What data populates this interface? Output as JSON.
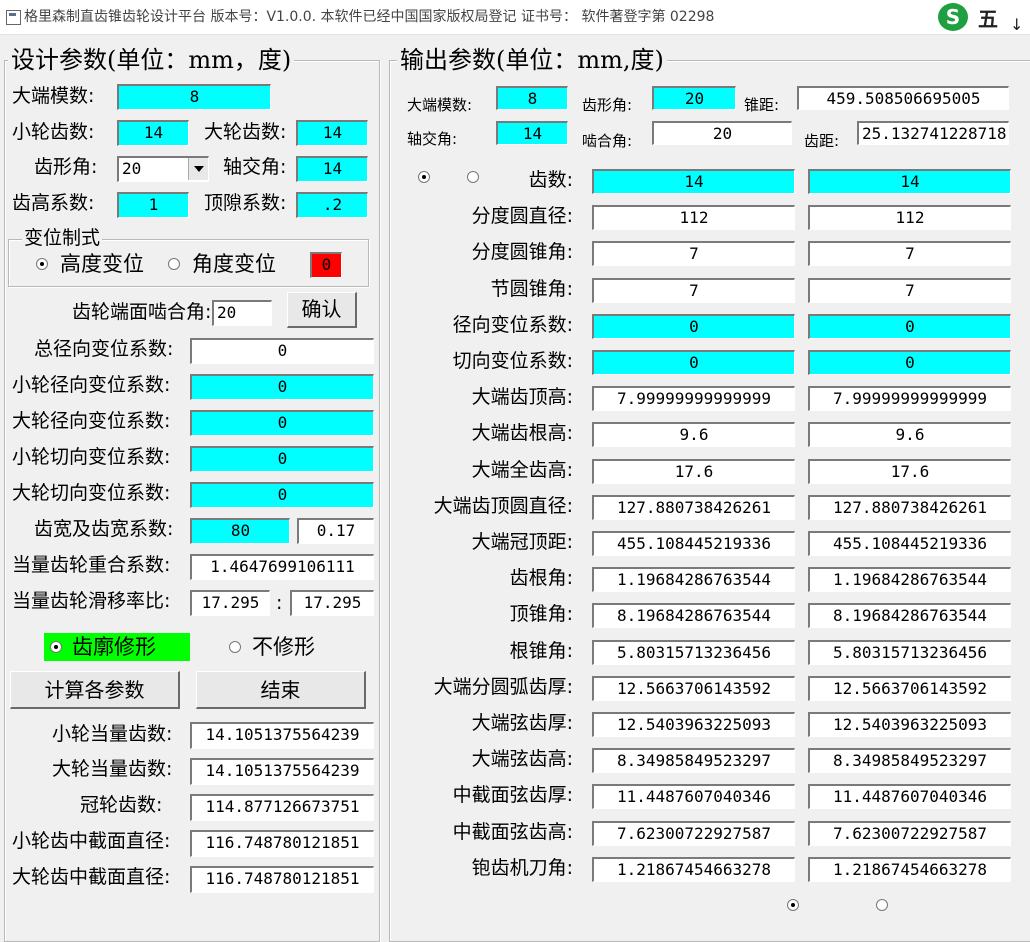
{
  "window": {
    "title": "格里森制直齿锥齿轮设计平台  版本号：V1.0.0.    本软件已经中国国家版权局登记  证书号：  软件著登字第 02298",
    "ime_logo": "S",
    "ime_label": "五",
    "ime_arrow": "↓"
  },
  "colors": {
    "cyan": "#00ffff",
    "green": "#00ff00",
    "red": "#ff0000"
  },
  "design": {
    "title": "设计参数(单位：mm，度)",
    "module_label": "大端模数:",
    "module": "8",
    "z1_label": "小轮齿数:",
    "z1": "14",
    "z2_label": "大轮齿数:",
    "z2": "14",
    "pressure_angle_label": "齿形角:",
    "pressure_angle": "20",
    "shaft_angle_label": "轴交角:",
    "shaft_angle": "14",
    "addendum_coef_label": "齿高系数:",
    "addendum_coef": "1",
    "clearance_coef_label": "顶隙系数:",
    "clearance_coef": ".2",
    "shift_group_title": "变位制式",
    "shift_height": "高度变位",
    "shift_angle": "角度变位",
    "shift_indicator": "0",
    "mesh_angle_label": "齿轮端面啮合角:",
    "mesh_angle": "20",
    "confirm": "确认",
    "total_radial_label": "总径向变位系数:",
    "total_radial": "0",
    "pinion_radial_label": "小轮径向变位系数:",
    "pinion_radial": "0",
    "gear_radial_label": "大轮径向变位系数:",
    "gear_radial": "0",
    "pinion_tangential_label": "小轮切向变位系数:",
    "pinion_tangential": "0",
    "gear_tangential_label": "大轮切向变位系数:",
    "gear_tangential": "0",
    "face_width_label": "齿宽及齿宽系数:",
    "face_width": "80",
    "face_width_coef": "0.17",
    "contact_ratio_label": "当量齿轮重合系数:",
    "contact_ratio": "1.4647699106111",
    "slip_ratio_label": "当量齿轮滑移率比:",
    "slip_ratio_1": "17.295",
    "slip_sep": ":",
    "slip_ratio_2": "17.295",
    "modify_on": "齿廓修形",
    "modify_off": "不修形",
    "calc_button": "计算各参数",
    "end_button": "结束",
    "pinion_virtual_label": "小轮当量齿数:",
    "pinion_virtual": "14.1051375564239",
    "gear_virtual_label": "大轮当量齿数:",
    "gear_virtual": "14.1051375564239",
    "crown_teeth_label": "冠轮齿数:",
    "crown_teeth": "114.877126673751",
    "pinion_mid_dia_label": "小轮齿中截面直径:",
    "pinion_mid_dia": "116.748780121851",
    "gear_mid_dia_label": "大轮齿中截面直径:",
    "gear_mid_dia": "116.748780121851"
  },
  "output": {
    "title": "输出参数(单位：mm,度)",
    "module_label": "大端模数:",
    "module": "8",
    "pressure_angle_label": "齿形角:",
    "pressure_angle": "20",
    "cone_distance_label": "锥距:",
    "cone_distance": "459.508506695005",
    "shaft_angle_label": "轴交角:",
    "shaft_angle": "14",
    "mesh_angle_label": "啮合角:",
    "mesh_angle": "20",
    "pitch_label": "齿距:",
    "pitch": "25.132741228718",
    "rows": [
      {
        "label": "齿数:",
        "v1": "14",
        "v2": "14",
        "cyan": true
      },
      {
        "label": "分度圆直径:",
        "v1": "112",
        "v2": "112",
        "cyan": false
      },
      {
        "label": "分度圆锥角:",
        "v1": "7",
        "v2": "7",
        "cyan": false
      },
      {
        "label": "节圆锥角:",
        "v1": "7",
        "v2": "7",
        "cyan": false
      },
      {
        "label": "径向变位系数:",
        "v1": "0",
        "v2": "0",
        "cyan": true
      },
      {
        "label": "切向变位系数:",
        "v1": "0",
        "v2": "0",
        "cyan": true
      },
      {
        "label": "大端齿顶高:",
        "v1": "7.99999999999999",
        "v2": "7.99999999999999",
        "cyan": false
      },
      {
        "label": "大端齿根高:",
        "v1": "9.6",
        "v2": "9.6",
        "cyan": false
      },
      {
        "label": "大端全齿高:",
        "v1": "17.6",
        "v2": "17.6",
        "cyan": false
      },
      {
        "label": "大端齿顶圆直径:",
        "v1": "127.880738426261",
        "v2": "127.880738426261",
        "cyan": false
      },
      {
        "label": "大端冠顶距:",
        "v1": "455.108445219336",
        "v2": "455.108445219336",
        "cyan": false
      },
      {
        "label": "齿根角:",
        "v1": "1.19684286763544",
        "v2": "1.19684286763544",
        "cyan": false
      },
      {
        "label": "顶锥角:",
        "v1": "8.19684286763544",
        "v2": "8.19684286763544",
        "cyan": false
      },
      {
        "label": "根锥角:",
        "v1": "5.80315713236456",
        "v2": "5.80315713236456",
        "cyan": false
      },
      {
        "label": "大端分圆弧齿厚:",
        "v1": "12.5663706143592",
        "v2": "12.5663706143592",
        "cyan": false
      },
      {
        "label": "大端弦齿厚:",
        "v1": "12.5403963225093",
        "v2": "12.5403963225093",
        "cyan": false
      },
      {
        "label": "大端弦齿高:",
        "v1": "8.34985849523297",
        "v2": "8.34985849523297",
        "cyan": false
      },
      {
        "label": "中截面弦齿厚:",
        "v1": "11.4487607040346",
        "v2": "11.4487607040346",
        "cyan": false
      },
      {
        "label": "中截面弦齿高:",
        "v1": "7.62300722927587",
        "v2": "7.62300722927587",
        "cyan": false
      },
      {
        "label": "铇齿机刀角:",
        "v1": "1.21867454663278",
        "v2": "1.21867454663278",
        "cyan": false
      }
    ]
  }
}
